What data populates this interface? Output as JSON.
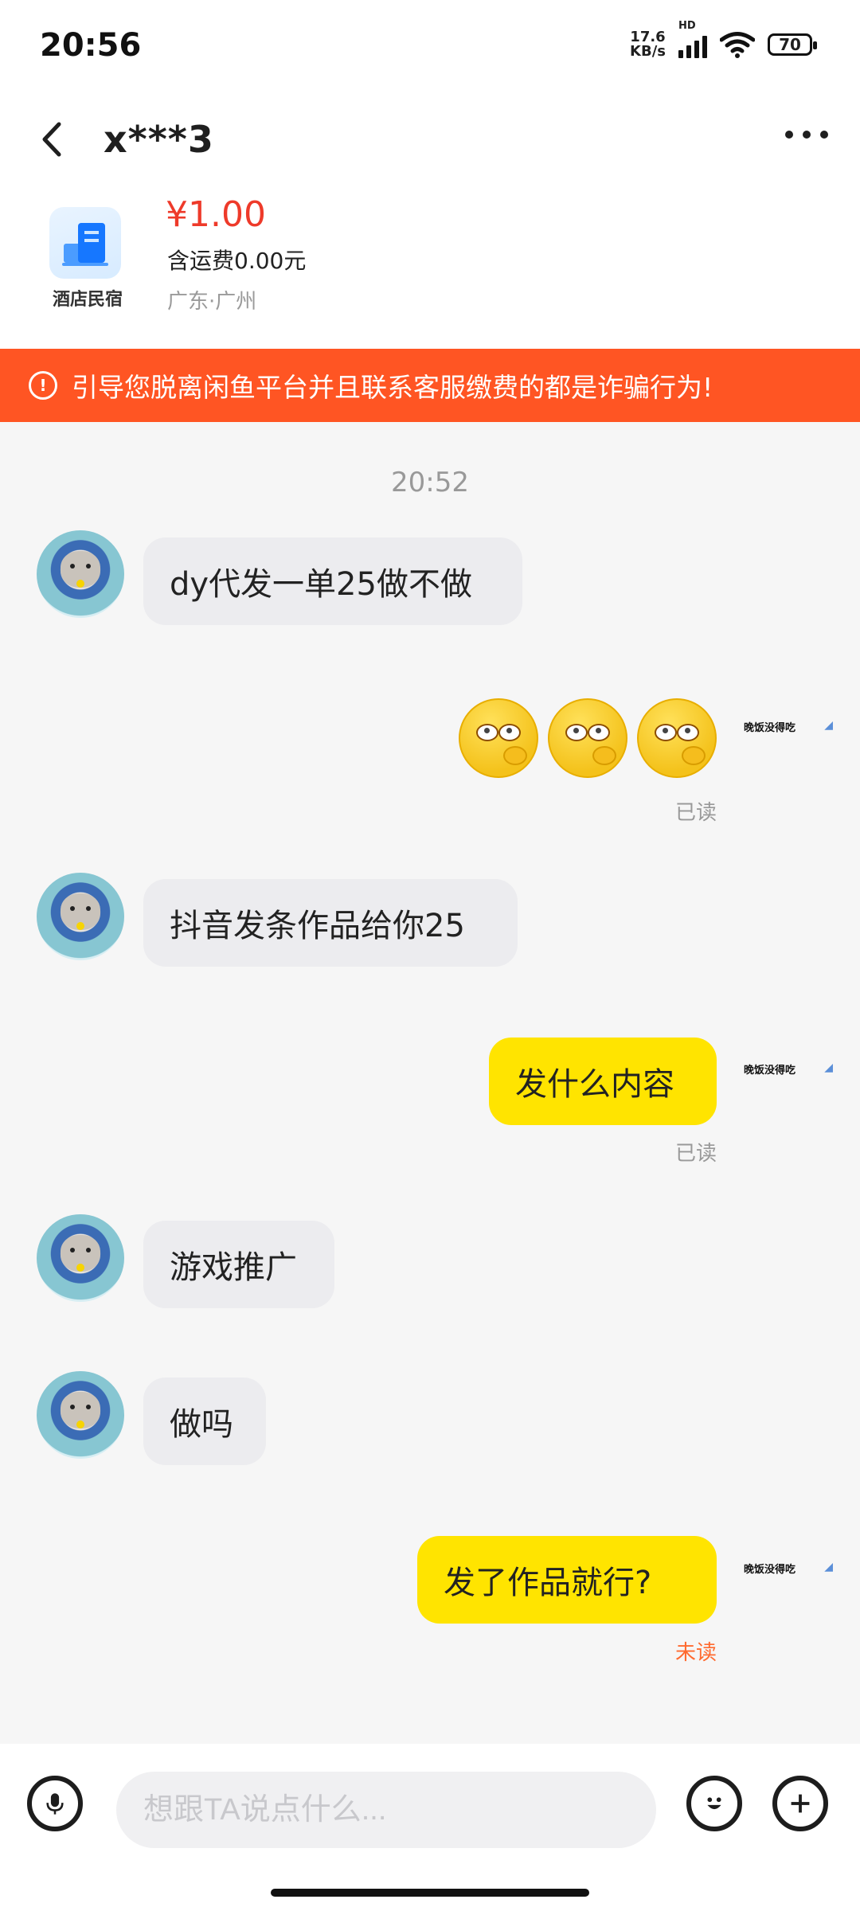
{
  "status_bar": {
    "time": "20:56",
    "network_speed_top": "17.6",
    "network_speed_bottom": "KB/s",
    "hd_label": "HD",
    "battery": "70"
  },
  "header": {
    "title": "x***3"
  },
  "product": {
    "category": "酒店民宿",
    "price": "¥1.00",
    "shipping": "含运费0.00元",
    "location": "广东·广州"
  },
  "warning": {
    "text": "引导您脱离闲鱼平台并且联系客服缴费的都是诈骗行为!"
  },
  "chat": {
    "timestamp": "20:52",
    "messages": [
      {
        "sender": "other",
        "text": "dy代发一单25做不做"
      },
      {
        "sender": "self",
        "type": "emoji",
        "status": "已读"
      },
      {
        "sender": "other",
        "text": "抖音发条作品给你25"
      },
      {
        "sender": "self",
        "text": "发什么内容",
        "status": "已读"
      },
      {
        "sender": "other",
        "text": "游戏推广"
      },
      {
        "sender": "other",
        "text": "做吗"
      },
      {
        "sender": "self",
        "text": "发了作品就行?",
        "status": "未读"
      }
    ],
    "self_name": "晚饭没得吃"
  },
  "input": {
    "placeholder": "想跟TA说点什么..."
  },
  "icons": {
    "back": "back-chevron-icon",
    "more": "more-dots-icon",
    "voice": "microphone-icon",
    "emoji": "emoji-icon",
    "add": "plus-icon",
    "warning": "warning-circle-icon"
  },
  "colors": {
    "warning_bg": "#ff5523",
    "price": "#ee3a2a",
    "outgoing_bubble": "#ffe400",
    "incoming_bubble": "#ececef",
    "unread": "#ff6a2f"
  }
}
